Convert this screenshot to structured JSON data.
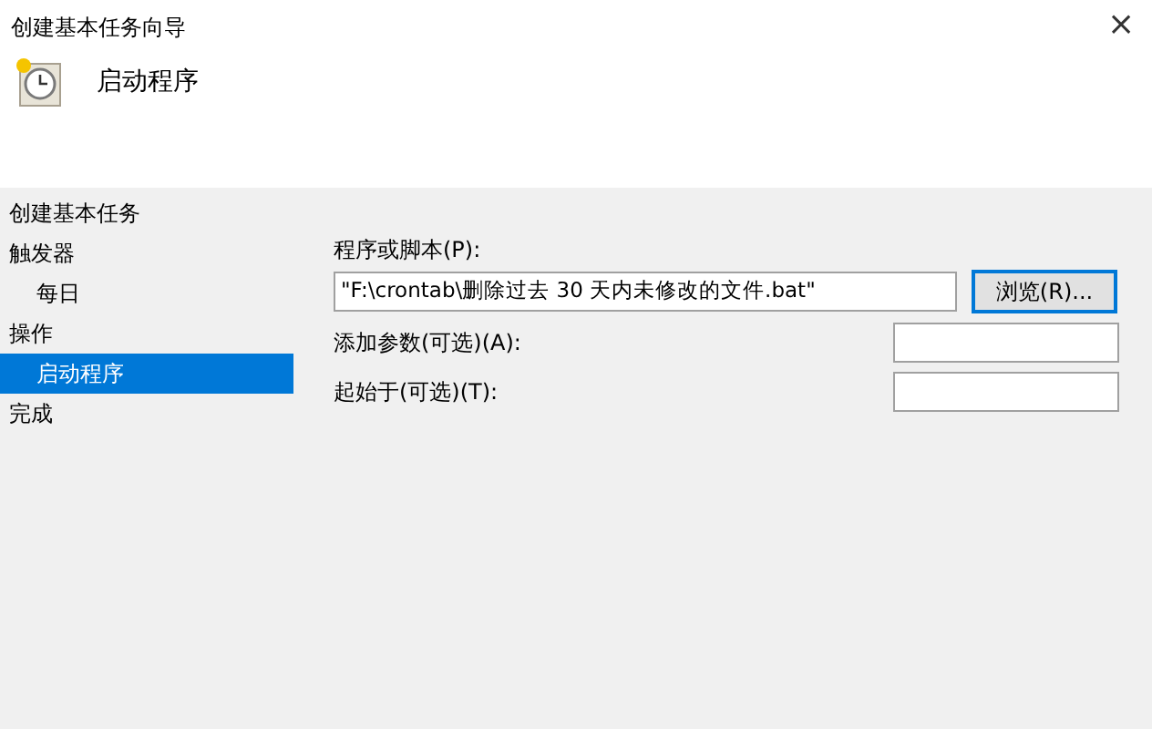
{
  "window": {
    "title": "创建基本任务向导",
    "close": "×"
  },
  "header": {
    "title": "启动程序"
  },
  "steps": [
    {
      "label": "创建基本任务",
      "selected": false
    },
    {
      "label": "触发器",
      "selected": false,
      "children": [
        {
          "label": "每日",
          "selected": false
        }
      ]
    },
    {
      "label": "操作",
      "selected": false,
      "children": [
        {
          "label": "启动程序",
          "selected": true
        }
      ]
    },
    {
      "label": "完成",
      "selected": false
    }
  ],
  "form": {
    "program_label": "程序或脚本(P):",
    "program_value": "\"F:\\crontab\\删除过去 30 天内未修改的文件.bat\"",
    "browse_button": "浏览(R)...",
    "fields": [
      {
        "label": "添加参数(可选)(A):"
      },
      {
        "label": "起始于(可选)(T):"
      }
    ]
  }
}
